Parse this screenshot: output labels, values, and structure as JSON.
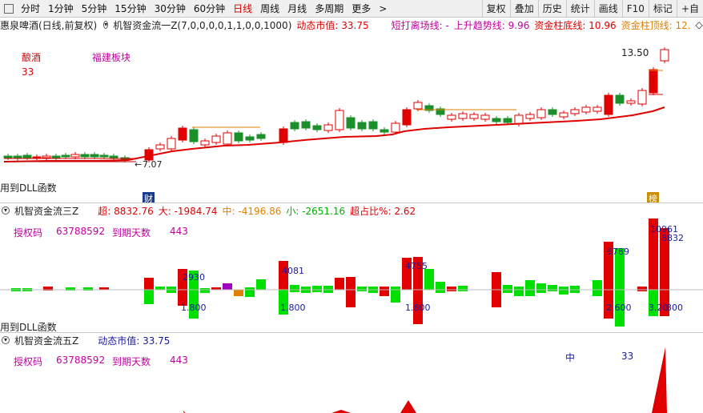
{
  "toolbar": {
    "timeframes": [
      "分时",
      "1分钟",
      "5分钟",
      "15分钟",
      "30分钟",
      "60分钟",
      "日线",
      "周线",
      "月线",
      "多周期",
      "更多"
    ],
    "active_timeframe": "日线",
    "more_arrow": ">",
    "buttons": [
      "复权",
      "叠加",
      "历史",
      "统计",
      "画线",
      "F10",
      "标记",
      "+自"
    ]
  },
  "main": {
    "stock": "惠泉啤酒(日线,前复权)",
    "indicator_name": "机智资金流一Z(7,0,0,0,0,1,1,0,0,1000)",
    "market_cap": "动态市值: 33.75",
    "short_exit": "短打离场线: -",
    "uptrend": "上升趋势线: 9.96",
    "fund_bottom": "资金柱底线: 10.96",
    "fund_top": "资金柱顶线: 12.",
    "label_sector1": "酿酒",
    "label_sector2": "福建板块",
    "label_33": "33",
    "price_high": "13.50",
    "price_low": "7.07",
    "dll_note": "用到DLL函数",
    "badge_left": "财",
    "badge_right": "榜"
  },
  "panel2": {
    "name": "机智资金流三Z",
    "super": "超: 8832.76",
    "big": "大: -1984.74",
    "mid": "中: -4196.86",
    "small": "小: -2651.16",
    "ratio": "超占比%: 2.62",
    "auth_label": "授权码",
    "auth_code": "63788592",
    "expire_label": "到期天数",
    "expire_days": "443",
    "dll_note": "用到DLL函数",
    "annotations": [
      "2930",
      "1.800",
      "4081",
      "1.800",
      "4755",
      "1.800",
      "6789",
      "2.600",
      "10961",
      "8832",
      "3.20",
      "800"
    ]
  },
  "panel3": {
    "name": "机智资金流五Z",
    "market_cap": "动态市值: 33.75",
    "auth_label": "授权码",
    "auth_code": "63788592",
    "expire_label": "到期天数",
    "expire_days": "443",
    "mid_label": "中",
    "mid_value": "33"
  },
  "colors": {
    "up": "#e00000",
    "down": "#1a8f2a",
    "green_bar": "#00e000",
    "ma": "#e00000"
  },
  "chart_data": {
    "type": "candlestick",
    "note": "daily K-line with fund flow panels",
    "price_marks": [
      "13.50",
      "7.07"
    ]
  }
}
